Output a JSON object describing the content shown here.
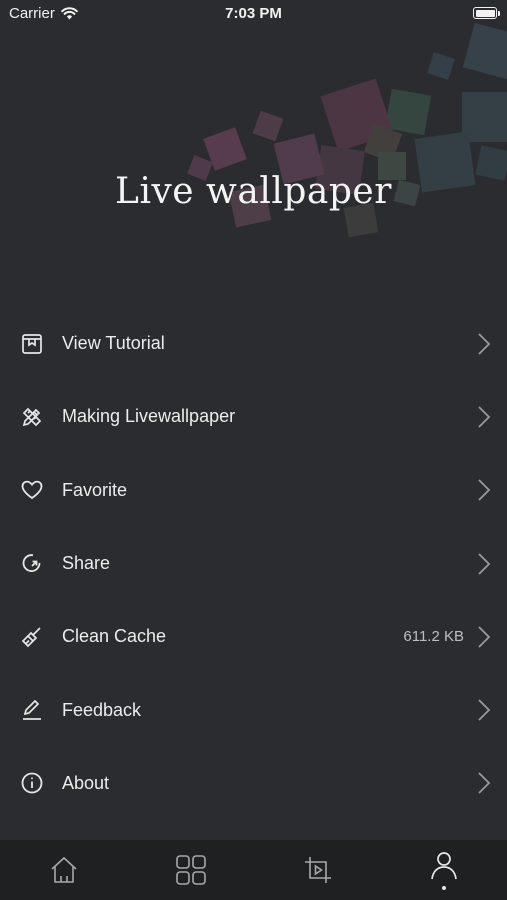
{
  "status_bar": {
    "carrier": "Carrier",
    "time": "7:03 PM"
  },
  "hero": {
    "title": "Live wallpaper"
  },
  "menu": {
    "items": [
      {
        "label": "View Tutorial",
        "icon": "book-icon",
        "value": ""
      },
      {
        "label": "Making Livewallpaper",
        "icon": "pencil-ruler-icon",
        "value": ""
      },
      {
        "label": "Favorite",
        "icon": "heart-icon",
        "value": ""
      },
      {
        "label": "Share",
        "icon": "share-icon",
        "value": ""
      },
      {
        "label": "Clean Cache",
        "icon": "broom-icon",
        "value": "611.2 KB"
      },
      {
        "label": "Feedback",
        "icon": "edit-icon",
        "value": ""
      },
      {
        "label": "About",
        "icon": "info-icon",
        "value": ""
      }
    ]
  },
  "tab_bar": {
    "tabs": [
      {
        "icon": "home-icon",
        "active": false
      },
      {
        "icon": "grid-icon",
        "active": false
      },
      {
        "icon": "crop-play-icon",
        "active": false
      },
      {
        "icon": "profile-icon",
        "active": true
      }
    ]
  },
  "colors": {
    "background": "#2b2c2f",
    "tab_bar": "#1f2022",
    "text": "#ececec"
  }
}
